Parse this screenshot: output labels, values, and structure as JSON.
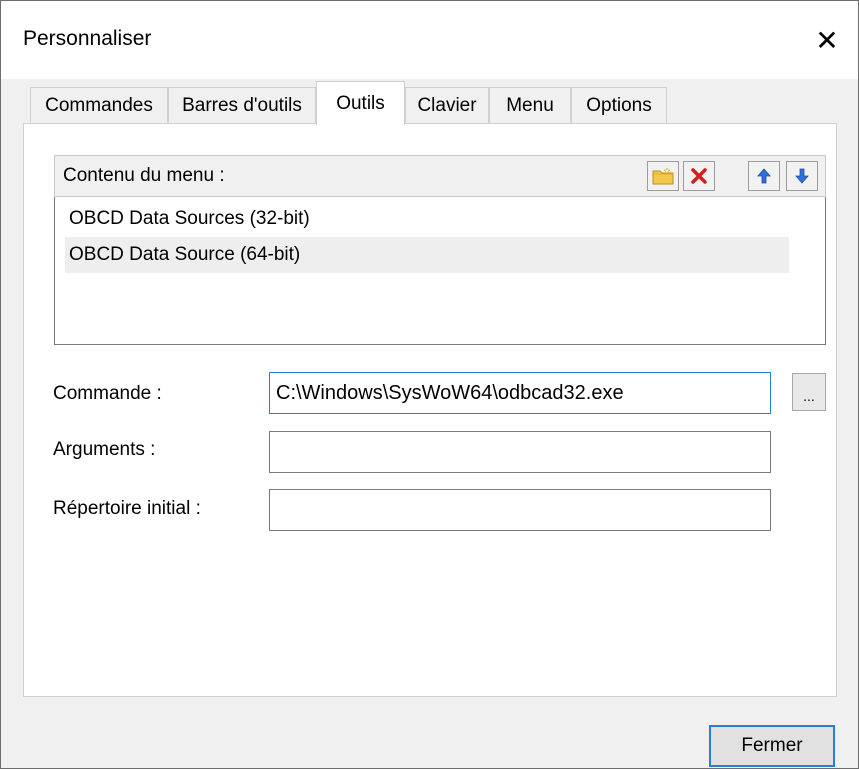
{
  "window": {
    "title": "Personnaliser"
  },
  "tabs": [
    {
      "label": "Commandes"
    },
    {
      "label": "Barres d'outils"
    },
    {
      "label": "Outils"
    },
    {
      "label": "Clavier"
    },
    {
      "label": "Menu"
    },
    {
      "label": "Options"
    }
  ],
  "active_tab": "Outils",
  "menu_group": {
    "label": "Contenu du menu :",
    "toolbar_icons": [
      "new-folder-icon",
      "delete-icon",
      "move-up-icon",
      "move-down-icon"
    ],
    "items": [
      {
        "label": "OBCD Data Sources (32-bit)"
      },
      {
        "label": "OBCD Data Source (64-bit)"
      }
    ],
    "selected_index": 1
  },
  "fields": {
    "command": {
      "label": "Commande :",
      "value": "C:\\Windows\\SysWoW64\\odbcad32.exe"
    },
    "arguments": {
      "label": "Arguments :",
      "value": ""
    },
    "initial_dir": {
      "label": "Répertoire initial :",
      "value": ""
    }
  },
  "browse_label": "...",
  "close_button_label": "Fermer",
  "colors": {
    "focus_blue": "#2a7fd4",
    "delete_red": "#d21f1f",
    "arrow_blue": "#2f6fd8",
    "folder_yellow": "#f3c84a"
  }
}
